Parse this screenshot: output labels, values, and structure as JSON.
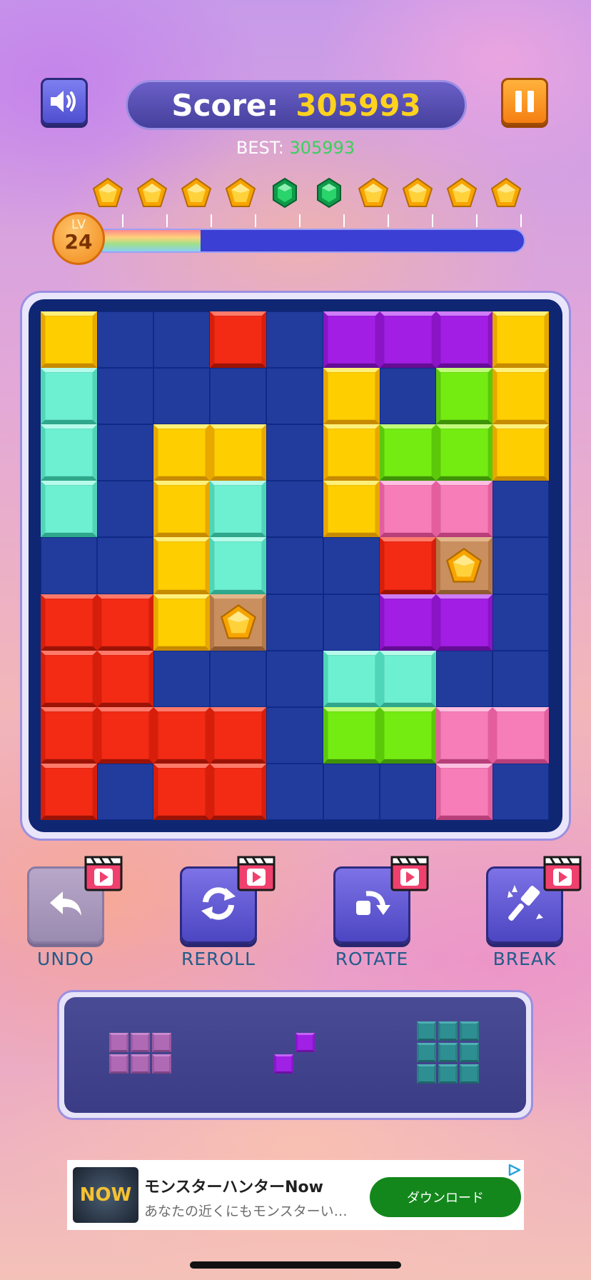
{
  "header": {
    "score_label": "Score:",
    "score_value": "305993",
    "best_label": "BEST:",
    "best_value": "305993"
  },
  "level": {
    "prefix": "LV",
    "number": "24",
    "progress_fraction": 0.25
  },
  "milestones": [
    "gold",
    "gold",
    "gold",
    "gold",
    "green",
    "green",
    "gold",
    "gold",
    "gold",
    "gold"
  ],
  "board": {
    "rows": [
      [
        "Y",
        "E",
        "E",
        "R",
        "E",
        "P",
        "P",
        "P",
        "Y"
      ],
      [
        "T",
        "E",
        "E",
        "E",
        "E",
        "Y",
        "E",
        "G",
        "Y"
      ],
      [
        "T",
        "E",
        "Y",
        "Y",
        "E",
        "Y",
        "G",
        "G",
        "Y"
      ],
      [
        "T",
        "E",
        "Y",
        "T",
        "E",
        "Y",
        "K",
        "K",
        "E"
      ],
      [
        "E",
        "E",
        "Y",
        "T",
        "E",
        "E",
        "R",
        "*",
        "E"
      ],
      [
        "R",
        "R",
        "Y",
        "*",
        "E",
        "E",
        "P",
        "P",
        "E"
      ],
      [
        "R",
        "R",
        "E",
        "E",
        "E",
        "T",
        "T",
        "E",
        "E"
      ],
      [
        "R",
        "R",
        "R",
        "R",
        "E",
        "G",
        "G",
        "K",
        "K"
      ],
      [
        "R",
        "E",
        "R",
        "R",
        "E",
        "E",
        "E",
        "K",
        "E"
      ]
    ],
    "colors": {
      "Y": [
        "#ffce00",
        "#fff07a",
        "#e8a800",
        "#c78a00"
      ],
      "R": [
        "#f32a14",
        "#ff7a6a",
        "#d61e0b",
        "#9c1306"
      ],
      "P": [
        "#a21ee4",
        "#cf7cf8",
        "#8a14c6",
        "#640d95"
      ],
      "T": [
        "#6df0d2",
        "#b6fbea",
        "#4fd6b8",
        "#2fa78b"
      ],
      "G": [
        "#74ec12",
        "#c2fb7c",
        "#5cc80a",
        "#3f9306"
      ],
      "K": [
        "#f77db8",
        "#ffbfe0",
        "#e45e9e",
        "#b83f79"
      ]
    }
  },
  "powerups": [
    {
      "label": "UNDO",
      "icon": "undo-icon",
      "enabled": false
    },
    {
      "label": "REROLL",
      "icon": "reroll-icon",
      "enabled": true
    },
    {
      "label": "ROTATE",
      "icon": "rotate-icon",
      "enabled": true
    },
    {
      "label": "BREAK",
      "icon": "hammer-icon",
      "enabled": true
    }
  ],
  "tray": [
    {
      "name": "piece-2x3-pink",
      "color": "pink"
    },
    {
      "name": "piece-diagonal-purple",
      "color": "purple"
    },
    {
      "name": "piece-3x3-teal",
      "color": "teal"
    }
  ],
  "ad": {
    "title": "モンスターハンターNow",
    "subtitle": "あなたの近くにもモンスターい…",
    "cta": "ダウンロード",
    "logo_text": "NOW"
  }
}
